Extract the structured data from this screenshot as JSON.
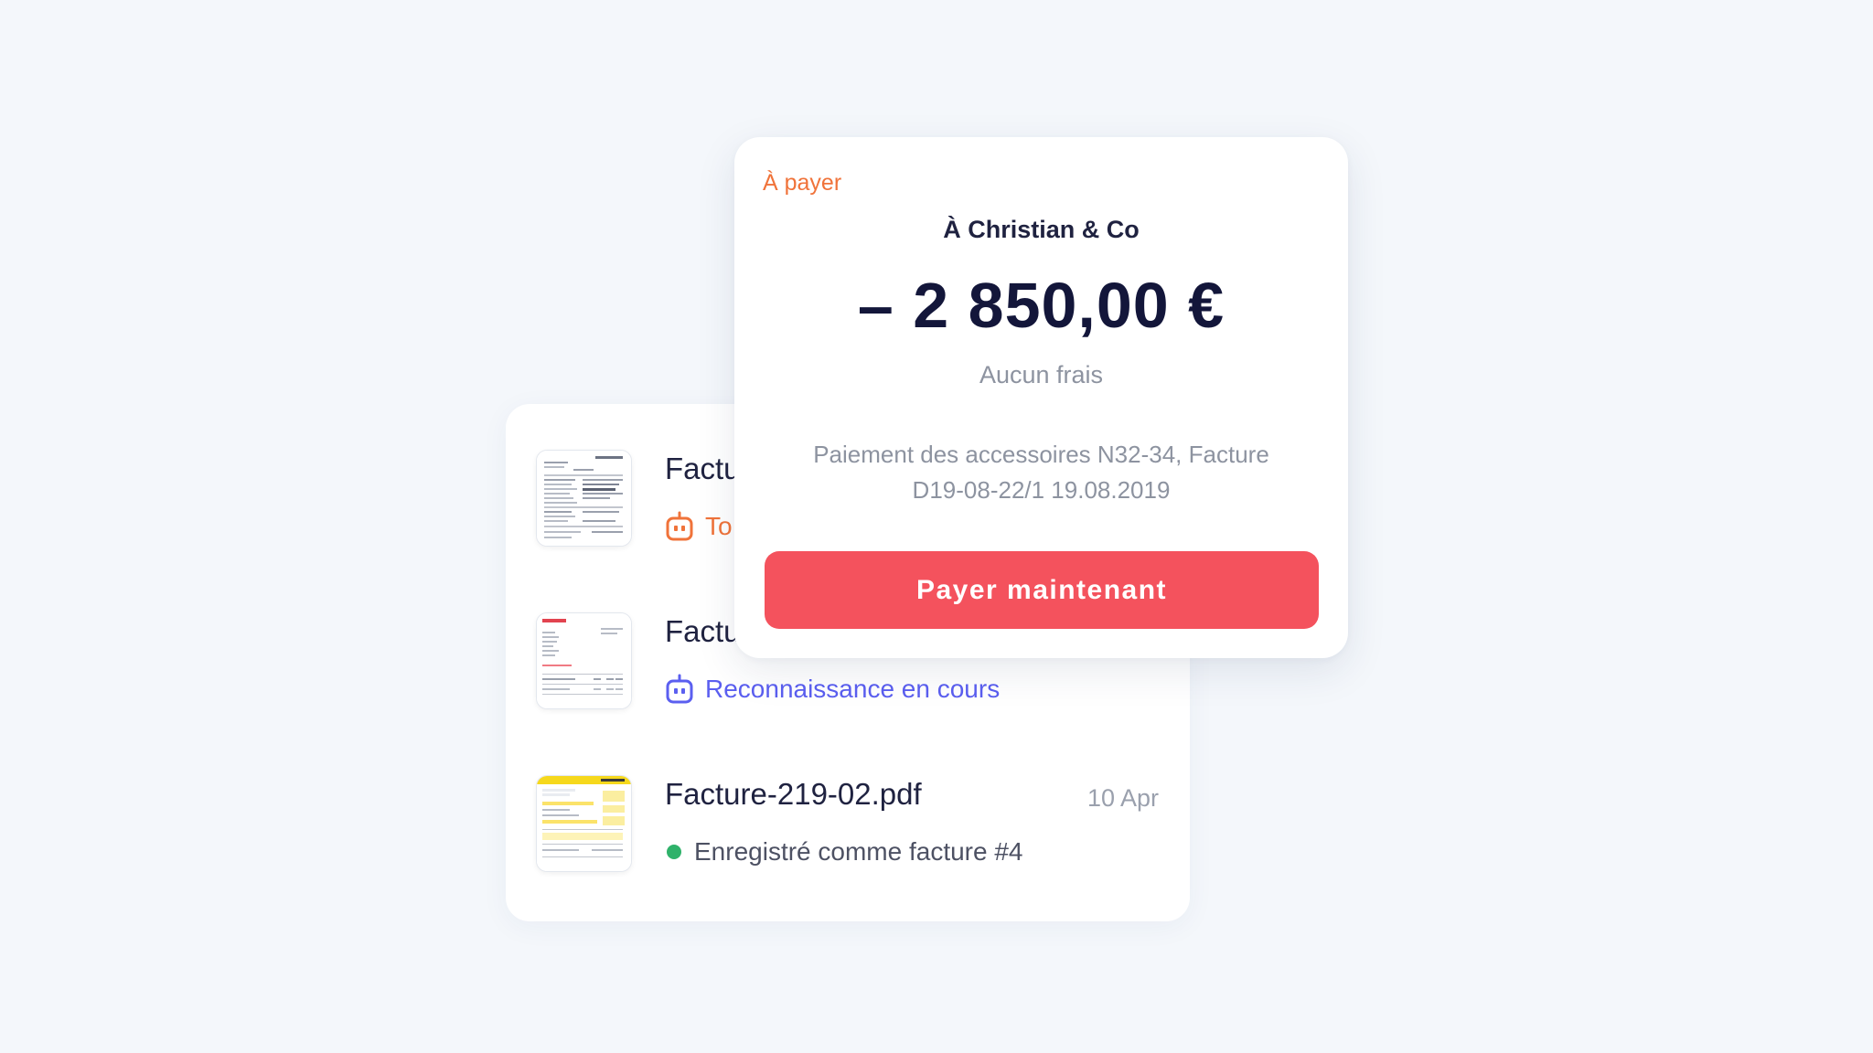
{
  "documents": [
    {
      "name": "Factu",
      "status": "To",
      "status_type": "processing",
      "status_color": "#f0733a"
    },
    {
      "name": "Factu",
      "status": "Reconnaissance en cours",
      "status_type": "recognition",
      "status_color": "#5b5ff0"
    },
    {
      "name": "Facture-219-02.pdf",
      "date": "10 Apr",
      "status": "Enregistré comme facture #4",
      "status_type": "saved",
      "status_color": "#2fb26a"
    }
  ],
  "payment": {
    "label": "À payer",
    "recipient": "À Christian & Co",
    "amount": "– 2 850,00 €",
    "fee": "Aucun frais",
    "description": "Paiement des accessoires N32-34, Facture D19-08-22/1 19.08.2019",
    "button_label": "Payer maintenant",
    "button_color": "#f4525d",
    "label_color": "#f0733a"
  },
  "icons": {
    "status_processing": "robot-icon",
    "status_recognition": "robot-icon",
    "status_saved": "green-dot-icon",
    "thumbnail": "invoice-thumbnail"
  }
}
